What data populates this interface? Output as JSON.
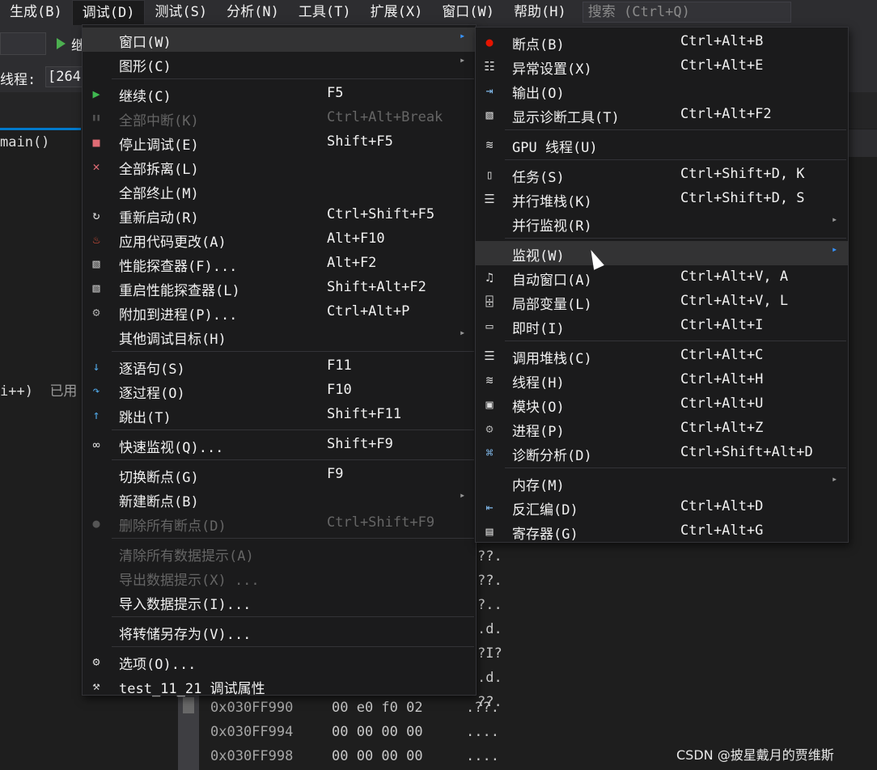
{
  "menubar": {
    "items": [
      {
        "label": "生成(B)"
      },
      {
        "label": "调试(D)",
        "active": true
      },
      {
        "label": "测试(S)"
      },
      {
        "label": "分析(N)"
      },
      {
        "label": "工具(T)"
      },
      {
        "label": "扩展(X)"
      },
      {
        "label": "窗口(W)"
      },
      {
        "label": "帮助(H)"
      }
    ],
    "search_placeholder": "搜索 (Ctrl+Q)"
  },
  "background": {
    "play_label": "继",
    "thread_label": "线程:",
    "thread_value": "[264",
    "function_label": "main()",
    "code_line": "i++)",
    "code_line_tail": "已用",
    "memory_peek": [
      "??.",
      "??.",
      "?..",
      ".d.",
      "?I?",
      ".d.",
      "??."
    ],
    "memory_rows": [
      {
        "addr": "0x030FF990",
        "bytes": "00 e0 f0 02",
        "ascii": ".??."
      },
      {
        "addr": "0x030FF994",
        "bytes": "00 00 00 00",
        "ascii": "...."
      },
      {
        "addr": "0x030FF998",
        "bytes": "00 00 00 00",
        "ascii": "...."
      }
    ],
    "watermark": "CSDN @披星戴月的贾维斯"
  },
  "debug_menu": {
    "items": [
      {
        "label": "窗口(W)",
        "icon": "",
        "shortcut": "",
        "submenu": true,
        "highlight": true
      },
      {
        "label": "图形(C)",
        "icon": "",
        "shortcut": "",
        "submenu": true
      },
      {
        "sep": true
      },
      {
        "label": "继续(C)",
        "icon": "continue-icon",
        "shortcut": "F5"
      },
      {
        "label": "全部中断(K)",
        "icon": "pause-icon",
        "shortcut": "Ctrl+Alt+Break",
        "disabled": true
      },
      {
        "label": "停止调试(E)",
        "icon": "stop-icon",
        "shortcut": "Shift+F5"
      },
      {
        "label": "全部拆离(L)",
        "icon": "detach-icon",
        "shortcut": ""
      },
      {
        "label": "全部终止(M)",
        "icon": "",
        "shortcut": ""
      },
      {
        "label": "重新启动(R)",
        "icon": "restart-icon",
        "shortcut": "Ctrl+Shift+F5"
      },
      {
        "label": "应用代码更改(A)",
        "icon": "hot-reload-icon",
        "shortcut": "Alt+F10"
      },
      {
        "label": "性能探查器(F)...",
        "icon": "profiler-icon",
        "shortcut": "Alt+F2"
      },
      {
        "label": "重启性能探查器(L)",
        "icon": "profiler-restart-icon",
        "shortcut": "Shift+Alt+F2"
      },
      {
        "label": "附加到进程(P)...",
        "icon": "attach-icon",
        "shortcut": "Ctrl+Alt+P"
      },
      {
        "label": "其他调试目标(H)",
        "icon": "",
        "shortcut": "",
        "submenu": true
      },
      {
        "sep": true
      },
      {
        "label": "逐语句(S)",
        "icon": "step-into-icon",
        "shortcut": "F11"
      },
      {
        "label": "逐过程(O)",
        "icon": "step-over-icon",
        "shortcut": "F10"
      },
      {
        "label": "跳出(T)",
        "icon": "step-out-icon",
        "shortcut": "Shift+F11"
      },
      {
        "sep": true
      },
      {
        "label": "快速监视(Q)...",
        "icon": "quickwatch-icon",
        "shortcut": "Shift+F9"
      },
      {
        "sep": true
      },
      {
        "label": "切换断点(G)",
        "icon": "",
        "shortcut": "F9"
      },
      {
        "label": "新建断点(B)",
        "icon": "",
        "shortcut": "",
        "submenu": true
      },
      {
        "label": "删除所有断点(D)",
        "icon": "delete-breakpoints-icon",
        "shortcut": "Ctrl+Shift+F9",
        "disabled": true
      },
      {
        "sep": true
      },
      {
        "label": "清除所有数据提示(A)",
        "icon": "",
        "shortcut": "",
        "disabled": true
      },
      {
        "label": "导出数据提示(X) ...",
        "icon": "",
        "shortcut": "",
        "disabled": true
      },
      {
        "label": "导入数据提示(I)...",
        "icon": "",
        "shortcut": ""
      },
      {
        "sep": true
      },
      {
        "label": "将转储另存为(V)...",
        "icon": "",
        "shortcut": ""
      },
      {
        "sep": true
      },
      {
        "label": "选项(O)...",
        "icon": "gear-icon",
        "shortcut": ""
      },
      {
        "label": "test_11_21 调试属性",
        "icon": "wrench-icon",
        "shortcut": ""
      }
    ]
  },
  "window_menu": {
    "items": [
      {
        "label": "断点(B)",
        "icon": "breakpoints-icon",
        "shortcut": "Ctrl+Alt+B"
      },
      {
        "label": "异常设置(X)",
        "icon": "exception-icon",
        "shortcut": "Ctrl+Alt+E"
      },
      {
        "label": "输出(O)",
        "icon": "output-icon",
        "shortcut": ""
      },
      {
        "label": "显示诊断工具(T)",
        "icon": "diagnostic-tools-icon",
        "shortcut": "Ctrl+Alt+F2"
      },
      {
        "sep": true
      },
      {
        "label": "GPU 线程(U)",
        "icon": "gpu-threads-icon",
        "shortcut": ""
      },
      {
        "sep": true
      },
      {
        "label": "任务(S)",
        "icon": "tasks-icon",
        "shortcut": "Ctrl+Shift+D, K"
      },
      {
        "label": "并行堆栈(K)",
        "icon": "parallel-stacks-icon",
        "shortcut": "Ctrl+Shift+D, S"
      },
      {
        "label": "并行监视(R)",
        "icon": "",
        "shortcut": "",
        "submenu": true
      },
      {
        "sep": true
      },
      {
        "label": "监视(W)",
        "icon": "",
        "shortcut": "",
        "submenu": true,
        "highlight": true
      },
      {
        "label": "自动窗口(A)",
        "icon": "autos-icon",
        "shortcut": "Ctrl+Alt+V, A"
      },
      {
        "label": "局部变量(L)",
        "icon": "locals-icon",
        "shortcut": "Ctrl+Alt+V, L"
      },
      {
        "label": "即时(I)",
        "icon": "immediate-icon",
        "shortcut": "Ctrl+Alt+I"
      },
      {
        "sep": true
      },
      {
        "label": "调用堆栈(C)",
        "icon": "call-stack-icon",
        "shortcut": "Ctrl+Alt+C"
      },
      {
        "label": "线程(H)",
        "icon": "threads-icon",
        "shortcut": "Ctrl+Alt+H"
      },
      {
        "label": "模块(O)",
        "icon": "modules-icon",
        "shortcut": "Ctrl+Alt+U"
      },
      {
        "label": "进程(P)",
        "icon": "processes-icon",
        "shortcut": "Ctrl+Alt+Z"
      },
      {
        "label": "诊断分析(D)",
        "icon": "diagnostic-analysis-icon",
        "shortcut": "Ctrl+Shift+Alt+D"
      },
      {
        "sep": true
      },
      {
        "label": "内存(M)",
        "icon": "",
        "shortcut": "",
        "submenu": true
      },
      {
        "label": "反汇编(D)",
        "icon": "disassembly-icon",
        "shortcut": "Ctrl+Alt+D"
      },
      {
        "label": "寄存器(G)",
        "icon": "registers-icon",
        "shortcut": "Ctrl+Alt+G"
      }
    ]
  }
}
